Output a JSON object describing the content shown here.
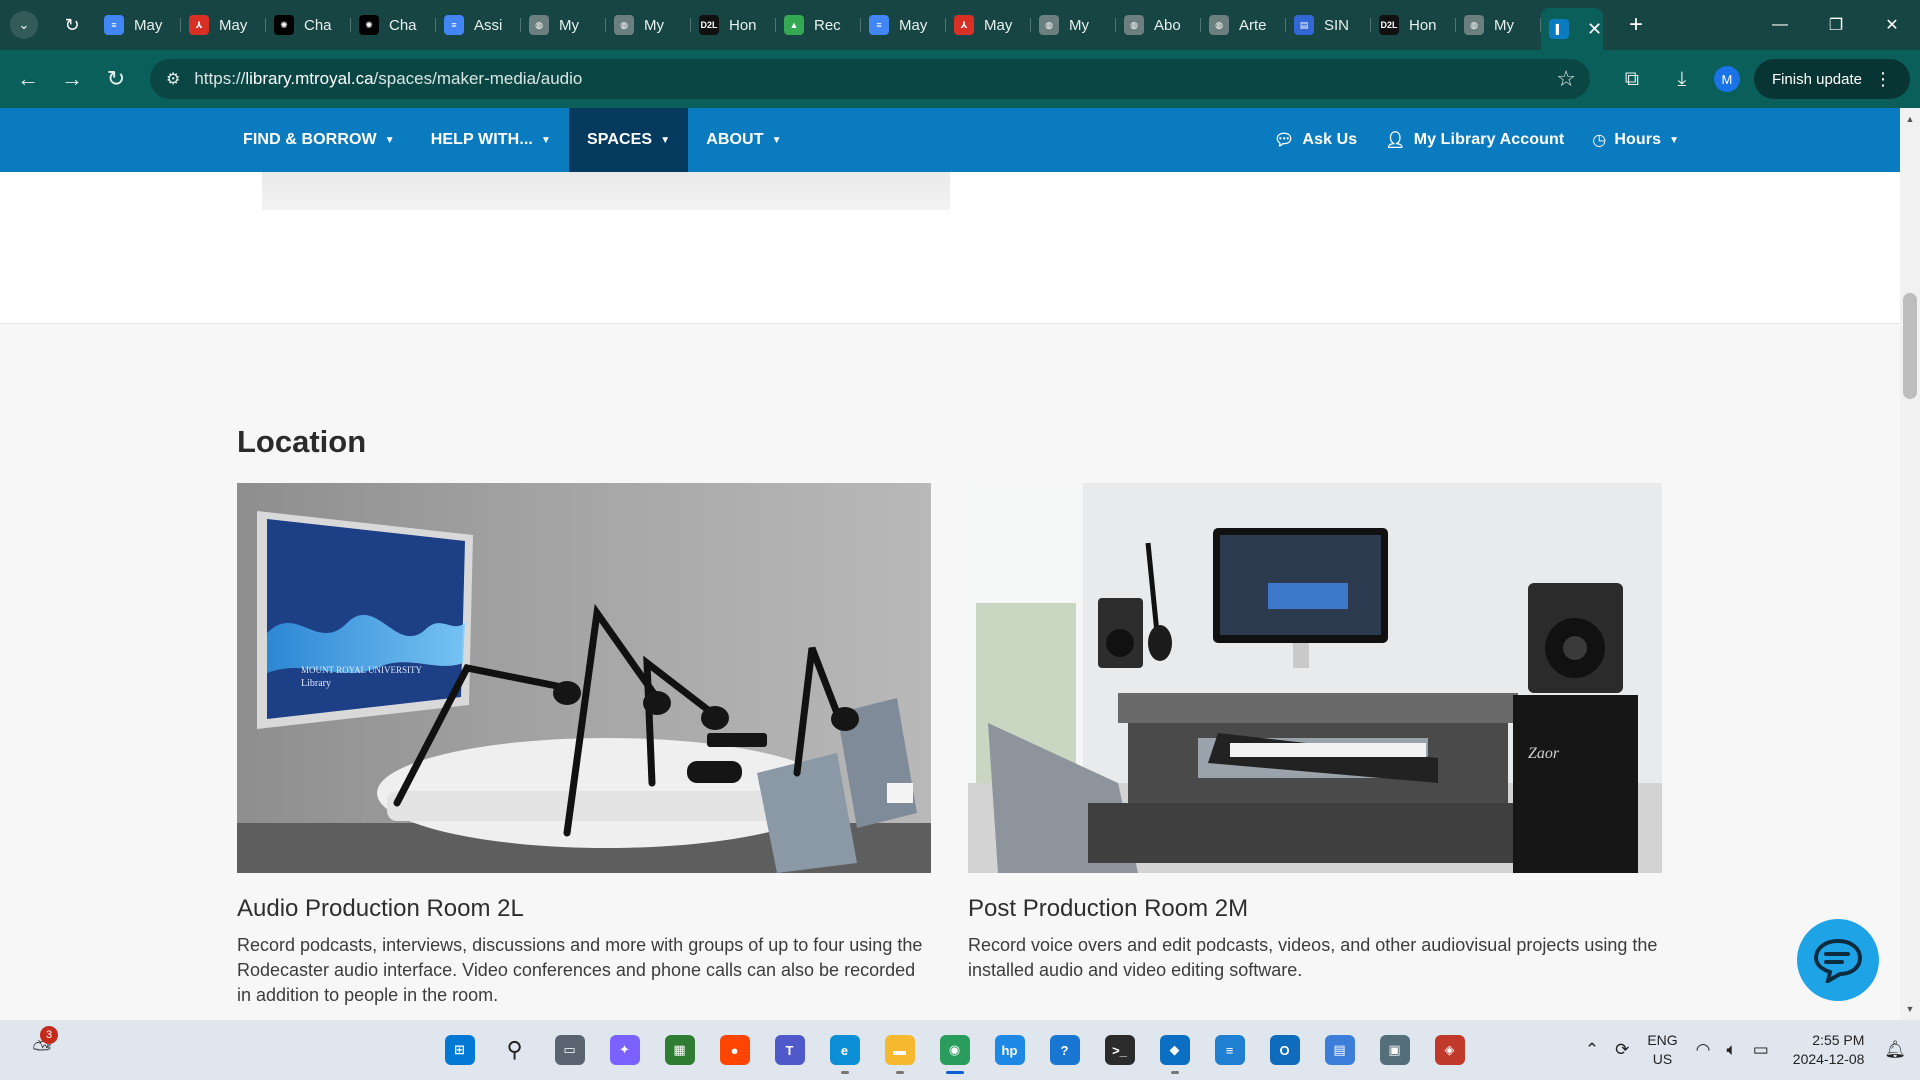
{
  "browser": {
    "tabs": [
      {
        "title": "May",
        "icon": "docs-icon",
        "color": "#4285f4"
      },
      {
        "title": "May",
        "icon": "pdf-icon",
        "color": "#d93025"
      },
      {
        "title": "Cha",
        "icon": "chatgpt-icon",
        "color": "#000000"
      },
      {
        "title": "Cha",
        "icon": "chatgpt-icon",
        "color": "#000000"
      },
      {
        "title": "Assi",
        "icon": "docs-icon",
        "color": "#4285f4"
      },
      {
        "title": "My",
        "icon": "globe-icon",
        "color": "#6b7f7e"
      },
      {
        "title": "My",
        "icon": "globe-icon",
        "color": "#6b7f7e"
      },
      {
        "title": "Hon",
        "icon": "d2l-icon",
        "color": "#111111"
      },
      {
        "title": "Rec",
        "icon": "drive-icon",
        "color": "#34a853"
      },
      {
        "title": "May",
        "icon": "docs-icon",
        "color": "#4285f4"
      },
      {
        "title": "May",
        "icon": "pdf-icon",
        "color": "#d93025"
      },
      {
        "title": "My",
        "icon": "globe-icon",
        "color": "#6b7f7e"
      },
      {
        "title": "Abo",
        "icon": "globe-icon",
        "color": "#6b7f7e"
      },
      {
        "title": "Arte",
        "icon": "globe-icon",
        "color": "#6b7f7e"
      },
      {
        "title": "SIN",
        "icon": "forms-icon",
        "color": "#3367d6"
      },
      {
        "title": "Hon",
        "icon": "d2l-icon",
        "color": "#111111"
      },
      {
        "title": "My",
        "icon": "globe-icon",
        "color": "#6b7f7e"
      }
    ],
    "active_tab_icon": "mru-icon",
    "url_prefix": "https://",
    "url_host": "library.mtroyal.ca",
    "url_path": "/spaces/maker-media/audio",
    "finish_update_label": "Finish update",
    "profile_initial": "M"
  },
  "site_nav": {
    "left": [
      {
        "label": "FIND & BORROW"
      },
      {
        "label": "HELP WITH..."
      },
      {
        "label": "SPACES"
      },
      {
        "label": "ABOUT"
      }
    ],
    "right": [
      {
        "label": "Ask Us",
        "icon": "chat-bubble-icon"
      },
      {
        "label": "My Library Account",
        "icon": "user-icon"
      },
      {
        "label": "Hours",
        "icon": "clock-icon"
      }
    ],
    "colors": {
      "bar": "#0a7bbf",
      "active": "#053a5e"
    }
  },
  "location": {
    "heading": "Location",
    "rooms": [
      {
        "title": "Audio Production Room 2L",
        "description": "Record podcasts, interviews, discussions and more with groups of up to four using the Rodecaster audio interface. Video conferences and phone calls can also be recorded in addition to people in the room.",
        "poster_text_1": "MOUNT ROYAL UNIVERSITY",
        "poster_text_2": "Library"
      },
      {
        "title": "Post Production Room 2M",
        "description": "Record voice overs and edit podcasts, videos, and other audiovisual projects using the installed audio and video editing software.",
        "speaker_logo": "Zaor"
      }
    ]
  },
  "taskbar": {
    "notification_count": "3",
    "language_line1": "ENG",
    "language_line2": "US",
    "time": "2:55 PM",
    "date": "2024-12-08",
    "apps": [
      {
        "name": "windows-start-icon",
        "color": "#0078d4",
        "label": "⊞"
      },
      {
        "name": "search-icon",
        "color": "#dfe6ee",
        "label": "⚲"
      },
      {
        "name": "task-view-icon",
        "color": "#5a6470",
        "label": "▭"
      },
      {
        "name": "copilot-icon",
        "color": "#7b61ff",
        "label": "✦"
      },
      {
        "name": "store-icon",
        "color": "#2e7d32",
        "label": "▦"
      },
      {
        "name": "reddit-icon",
        "color": "#ff4500",
        "label": "●"
      },
      {
        "name": "teams-icon",
        "color": "#5059c9",
        "label": "T"
      },
      {
        "name": "edge-icon",
        "color": "#0c8fd6",
        "label": "e"
      },
      {
        "name": "file-explorer-icon",
        "color": "#f5b82e",
        "label": "▬"
      },
      {
        "name": "chrome-icon",
        "color": "#2a9d5c",
        "label": "◉"
      },
      {
        "name": "myhp-icon",
        "color": "#1e88e5",
        "label": "hp"
      },
      {
        "name": "help-icon",
        "color": "#1976d2",
        "label": "?"
      },
      {
        "name": "terminal-icon",
        "color": "#2b2b2b",
        "label": ">_"
      },
      {
        "name": "vscode-icon",
        "color": "#0a6fc2",
        "label": "◆"
      },
      {
        "name": "notepad-icon",
        "color": "#1f7fd1",
        "label": "≡"
      },
      {
        "name": "outlook-icon",
        "color": "#0f6cbd",
        "label": "O"
      },
      {
        "name": "screen-icon",
        "color": "#3b7dd8",
        "label": "▤"
      },
      {
        "name": "remote-desktop-icon",
        "color": "#546e7a",
        "label": "▣"
      },
      {
        "name": "git-icon",
        "color": "#c0392b",
        "label": "◈"
      }
    ]
  }
}
